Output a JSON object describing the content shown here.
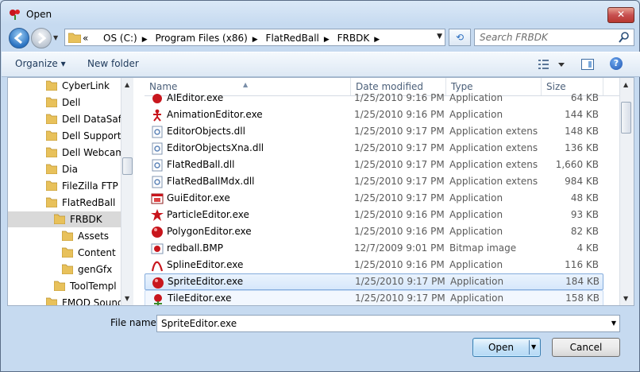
{
  "window": {
    "title": "Open",
    "close_label": "✕"
  },
  "address": {
    "crumbs": [
      "OS (C:)",
      "Program Files (x86)",
      "FlatRedBall",
      "FRBDK"
    ],
    "overflow": "«"
  },
  "search": {
    "placeholder": "Search FRBDK"
  },
  "toolbar": {
    "organize": "Organize ▾",
    "new_folder": "New folder",
    "help": "?"
  },
  "tree": {
    "items": [
      {
        "label": "CyberLink",
        "indent": 0
      },
      {
        "label": "Dell",
        "indent": 0
      },
      {
        "label": "Dell DataSafe",
        "indent": 0
      },
      {
        "label": "Dell Support C",
        "indent": 0
      },
      {
        "label": "Dell Webcam",
        "indent": 0
      },
      {
        "label": "Dia",
        "indent": 0
      },
      {
        "label": "FileZilla FTP C",
        "indent": 0
      },
      {
        "label": "FlatRedBall",
        "indent": 0
      },
      {
        "label": "FRBDK",
        "indent": 1,
        "selected": true
      },
      {
        "label": "Assets",
        "indent": 2
      },
      {
        "label": "Content",
        "indent": 2
      },
      {
        "label": "genGfx",
        "indent": 2
      },
      {
        "label": "ToolTempl",
        "indent": 1
      },
      {
        "label": "FMOD Sound",
        "indent": 0
      }
    ]
  },
  "columns": {
    "name": "Name",
    "date": "Date modified",
    "type": "Type",
    "size": "Size"
  },
  "files": [
    {
      "name": "AIEditor.exe",
      "date": "1/25/2010 9:16 PM",
      "type": "Application",
      "size": "64 KB",
      "icon": "red-app"
    },
    {
      "name": "AnimationEditor.exe",
      "date": "1/25/2010 9:16 PM",
      "type": "Application",
      "size": "144 KB",
      "icon": "figure"
    },
    {
      "name": "EditorObjects.dll",
      "date": "1/25/2010 9:17 PM",
      "type": "Application extens...",
      "size": "148 KB",
      "icon": "dll"
    },
    {
      "name": "EditorObjectsXna.dll",
      "date": "1/25/2010 9:17 PM",
      "type": "Application extens...",
      "size": "136 KB",
      "icon": "dll"
    },
    {
      "name": "FlatRedBall.dll",
      "date": "1/25/2010 9:17 PM",
      "type": "Application extens...",
      "size": "1,660 KB",
      "icon": "dll"
    },
    {
      "name": "FlatRedBallMdx.dll",
      "date": "1/25/2010 9:17 PM",
      "type": "Application extens...",
      "size": "984 KB",
      "icon": "dll"
    },
    {
      "name": "GuiEditor.exe",
      "date": "1/25/2010 9:17 PM",
      "type": "Application",
      "size": "48 KB",
      "icon": "window"
    },
    {
      "name": "ParticleEditor.exe",
      "date": "1/25/2010 9:16 PM",
      "type": "Application",
      "size": "93 KB",
      "icon": "burst"
    },
    {
      "name": "PolygonEditor.exe",
      "date": "1/25/2010 9:16 PM",
      "type": "Application",
      "size": "82 KB",
      "icon": "red-ball"
    },
    {
      "name": "redball.BMP",
      "date": "12/7/2009 9:01 PM",
      "type": "Bitmap image",
      "size": "4 KB",
      "icon": "bitmap"
    },
    {
      "name": "SplineEditor.exe",
      "date": "1/25/2010 9:16 PM",
      "type": "Application",
      "size": "116 KB",
      "icon": "spline"
    },
    {
      "name": "SpriteEditor.exe",
      "date": "1/25/2010 9:17 PM",
      "type": "Application",
      "size": "184 KB",
      "icon": "red-ball",
      "state": "selected"
    },
    {
      "name": "TileEditor.exe",
      "date": "1/25/2010 9:17 PM",
      "type": "Application",
      "size": "158 KB",
      "icon": "tile",
      "state": "hover"
    }
  ],
  "footer": {
    "file_name_label": "File name:",
    "file_name_value": "SpriteEditor.exe",
    "open_label": "Open",
    "cancel_label": "Cancel"
  }
}
